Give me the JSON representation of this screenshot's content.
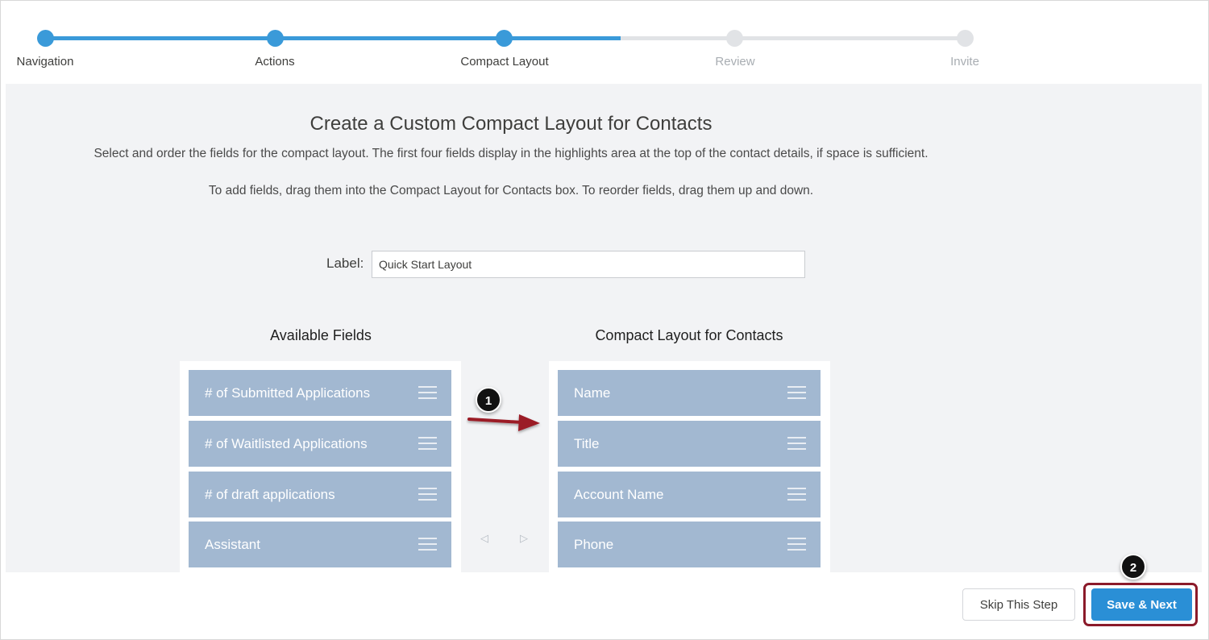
{
  "progress": {
    "steps": [
      {
        "label": "Navigation",
        "state": "done"
      },
      {
        "label": "Actions",
        "state": "done"
      },
      {
        "label": "Compact Layout",
        "state": "done"
      },
      {
        "label": "Review",
        "state": "todo"
      },
      {
        "label": "Invite",
        "state": "todo"
      }
    ]
  },
  "main": {
    "title": "Create a Custom Compact Layout for Contacts",
    "description": "Select and order the fields for the compact layout. The first four fields display in the highlights area at the top of the contact details, if space is sufficient.",
    "instruction": "To add fields, drag them into the Compact Layout for Contacts box. To reorder fields, drag them up and down.",
    "label_caption": "Label:",
    "label_value": "Quick Start Layout"
  },
  "available": {
    "title": "Available Fields",
    "items": [
      "# of Submitted Applications",
      "# of Waitlisted Applications",
      "# of draft applications",
      "Assistant"
    ]
  },
  "compact": {
    "title": "Compact Layout for Contacts",
    "items": [
      "Name",
      "Title",
      "Account Name",
      "Phone"
    ]
  },
  "move_controls": {
    "left": "◁",
    "right": "▷"
  },
  "annotations": {
    "one": "1",
    "two": "2"
  },
  "footer": {
    "skip_label": "Skip This Step",
    "save_label": "Save & Next"
  },
  "colors": {
    "accent": "#3a9ad9",
    "field_tile": "#a2b8d1",
    "callout_arrow": "#9b1b27",
    "highlight_border": "#8b1a2a"
  }
}
